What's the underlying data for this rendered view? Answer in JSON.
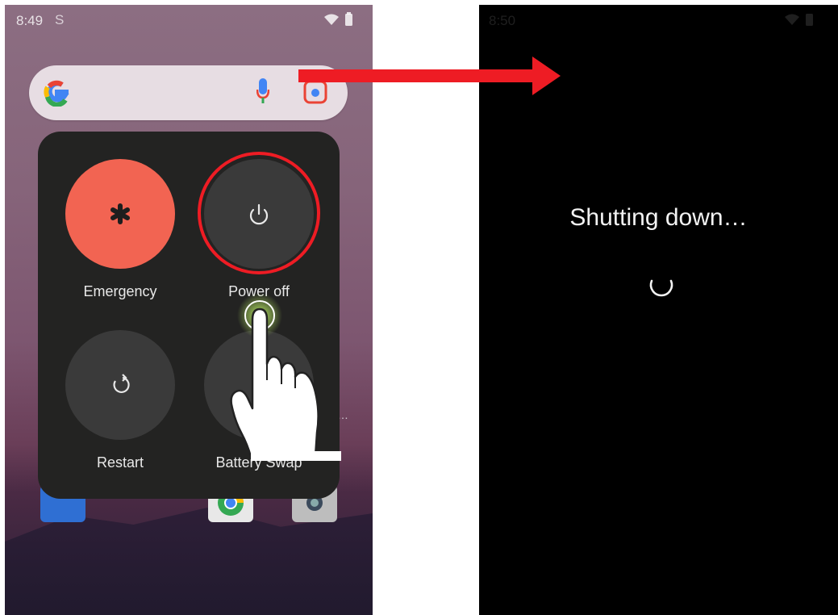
{
  "left_screen": {
    "status_time": "8:49",
    "search_bar": {
      "logo": "G"
    },
    "power_menu": {
      "emergency_label": "Emergency",
      "power_off_label": "Power off",
      "restart_label": "Restart",
      "battery_swap_label": "Battery Swap"
    }
  },
  "right_screen": {
    "status_time": "8:50",
    "message": "Shutting down…"
  },
  "colors": {
    "emergency": "#f26452",
    "highlight_ring": "#ee1c24",
    "arrow": "#ee1c24",
    "panel": "#232322"
  }
}
